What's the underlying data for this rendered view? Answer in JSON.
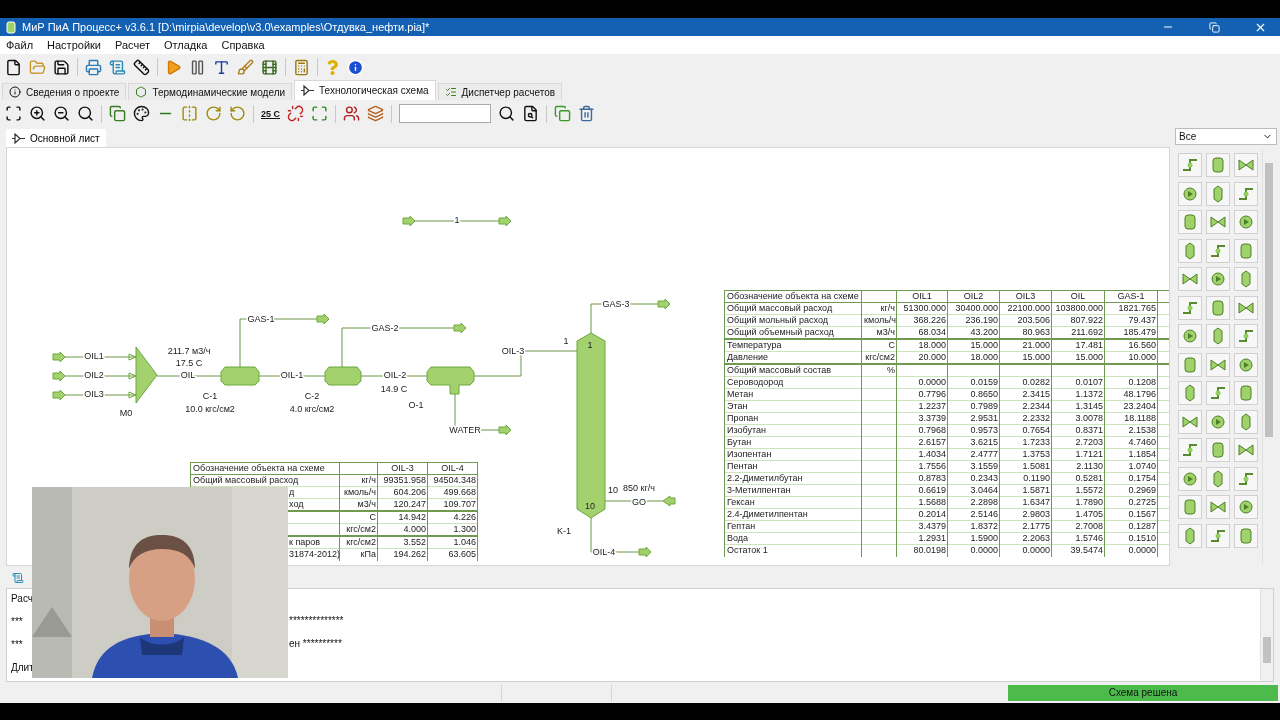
{
  "window": {
    "title": "МиР ПиА Процесс+ v3.6.1 [D:\\mirpia\\develop\\v3.0\\examples\\Отдувка_нефти.pia]*"
  },
  "menu": [
    "Файл",
    "Настройки",
    "Расчет",
    "Отладка",
    "Справка"
  ],
  "tabs": [
    {
      "label": "Сведения о проекте",
      "selected": false
    },
    {
      "label": "Термодинамические модели",
      "selected": false
    },
    {
      "label": "Технологическая схема",
      "selected": true
    },
    {
      "label": "Диспетчер расчетов",
      "selected": false
    }
  ],
  "scheme_toolbar": {
    "temperature_label": "25 C"
  },
  "sheet_tabs": [
    {
      "label": "Основной лист",
      "selected": true
    }
  ],
  "palette": {
    "filter": "Все"
  },
  "diagram": {
    "texts": [
      "1",
      "OIL1",
      "OIL2",
      "OIL3",
      "M0",
      "211.7 м3/ч",
      "17.5 C",
      "OIL",
      "C-1",
      "10.0 кгс/см2",
      "GAS-1",
      "OIL-1",
      "C-2",
      "4.0 кгс/см2",
      "GAS-2",
      "OIL-2",
      "14.9 C",
      "O-1",
      "WATER",
      "OIL-3",
      "1",
      "1",
      "10",
      "K-1",
      "GAS-3",
      "10",
      "850 кг/ч",
      "GO",
      "OIL-4"
    ]
  },
  "stream_table": {
    "columns": [
      "Обозначение объекта на схеме",
      "",
      "OIL1",
      "OIL2",
      "OIL3",
      "OIL",
      "GAS-1"
    ],
    "rows": [
      {
        "cells": [
          "Общий массовый расход",
          "кг/ч",
          "51300.000",
          "30400.000",
          "22100.000",
          "103800.000",
          "1821.765"
        ],
        "divider_above": false
      },
      {
        "cells": [
          "Общий мольный расход",
          "кмоль/ч",
          "368.226",
          "236.190",
          "203.506",
          "807.922",
          "79.437"
        ],
        "divider_above": false
      },
      {
        "cells": [
          "Общий объемный расход",
          "м3/ч",
          "68.034",
          "43.200",
          "80.963",
          "211.692",
          "185.479"
        ],
        "divider_above": false
      },
      {
        "cells": [
          "Температура",
          "C",
          "18.000",
          "15.000",
          "21.000",
          "17.481",
          "16.560"
        ],
        "divider_above": true
      },
      {
        "cells": [
          "Давление",
          "кгс/см2",
          "20.000",
          "18.000",
          "15.000",
          "15.000",
          "10.000"
        ],
        "divider_above": false
      },
      {
        "cells": [
          "Общий массовый состав",
          "%",
          "",
          "",
          "",
          "",
          ""
        ],
        "divider_above": true
      },
      {
        "cells": [
          "Сероводород",
          "",
          "0.0000",
          "0.0159",
          "0.0282",
          "0.0107",
          "0.1208"
        ],
        "divider_above": false
      },
      {
        "cells": [
          "Метан",
          "",
          "0.7796",
          "0.8650",
          "2.3415",
          "1.1372",
          "48.1796"
        ],
        "divider_above": false
      },
      {
        "cells": [
          "Этан",
          "",
          "1.2237",
          "0.7989",
          "2.2344",
          "1.3145",
          "23.2404"
        ],
        "divider_above": false
      },
      {
        "cells": [
          "Пропан",
          "",
          "3.3739",
          "2.9531",
          "2.2332",
          "3.0078",
          "18.1188"
        ],
        "divider_above": false
      },
      {
        "cells": [
          "Изобутан",
          "",
          "0.7968",
          "0.9573",
          "0.7654",
          "0.8371",
          "2.1538"
        ],
        "divider_above": false
      },
      {
        "cells": [
          "Бутан",
          "",
          "2.6157",
          "3.6215",
          "1.7233",
          "2.7203",
          "4.7460"
        ],
        "divider_above": false
      },
      {
        "cells": [
          "Изопентан",
          "",
          "1.4034",
          "2.4777",
          "1.3753",
          "1.7121",
          "1.1854"
        ],
        "divider_above": false
      },
      {
        "cells": [
          "Пентан",
          "",
          "1.7556",
          "3.1559",
          "1.5081",
          "2.1130",
          "1.0740"
        ],
        "divider_above": false
      },
      {
        "cells": [
          "2.2-Диметилбутан",
          "",
          "0.8783",
          "0.2343",
          "0.1190",
          "0.5281",
          "0.1754"
        ],
        "divider_above": false
      },
      {
        "cells": [
          "3-Метилпентан",
          "",
          "0.6619",
          "3.0464",
          "1.5871",
          "1.5572",
          "0.2969"
        ],
        "divider_above": false
      },
      {
        "cells": [
          "Гексан",
          "",
          "1.5688",
          "2.2898",
          "1.6347",
          "1.7890",
          "0.2725"
        ],
        "divider_above": false
      },
      {
        "cells": [
          "2.4-Диметилпентан",
          "",
          "0.2014",
          "2.5146",
          "2.9803",
          "1.4705",
          "0.1567"
        ],
        "divider_above": false
      },
      {
        "cells": [
          "Гептан",
          "",
          "3.4379",
          "1.8372",
          "2.1775",
          "2.7008",
          "0.1287"
        ],
        "divider_above": false
      },
      {
        "cells": [
          "Вода",
          "",
          "1.2931",
          "1.5900",
          "2.2063",
          "1.5746",
          "0.1510"
        ],
        "divider_above": false
      },
      {
        "cells": [
          "Остаток 1",
          "",
          "80.0198",
          "0.0000",
          "0.0000",
          "39.5474",
          "0.0000"
        ],
        "divider_above": false
      }
    ]
  },
  "small_table": {
    "columns": [
      "Обозначение объекта на схеме",
      "",
      "OIL-3",
      "OIL-4"
    ],
    "rows": [
      {
        "cells": [
          "Общий массовый расход",
          "кг/ч",
          "99351.958",
          "94504.348"
        ],
        "divider_above": false
      },
      {
        "cells": [
          "д",
          "кмоль/ч",
          "604.206",
          "499.668"
        ],
        "divider_above": false
      },
      {
        "cells": [
          "ход",
          "м3/ч",
          "120.247",
          "109.707"
        ],
        "divider_above": false
      },
      {
        "cells": [
          "",
          "C",
          "14.942",
          "4.226"
        ],
        "divider_above": true
      },
      {
        "cells": [
          "",
          "кгс/см2",
          "4.000",
          "1.300"
        ],
        "divider_above": false
      },
      {
        "cells": [
          "к паров",
          "кгс/см2",
          "3.552",
          "1.046"
        ],
        "divider_above": true
      },
      {
        "cells": [
          "31874-2012)",
          "кПа",
          "194.262",
          "63.605"
        ],
        "divider_above": false
      }
    ]
  },
  "log": {
    "lines": [
      {
        "left": "Расч"
      },
      {
        "left": "***",
        "right": "**************"
      },
      {
        "left": "***",
        "right": "ен **********"
      },
      {
        "left": "Длит"
      }
    ]
  },
  "status_bar": {
    "message": "Схема решена"
  }
}
